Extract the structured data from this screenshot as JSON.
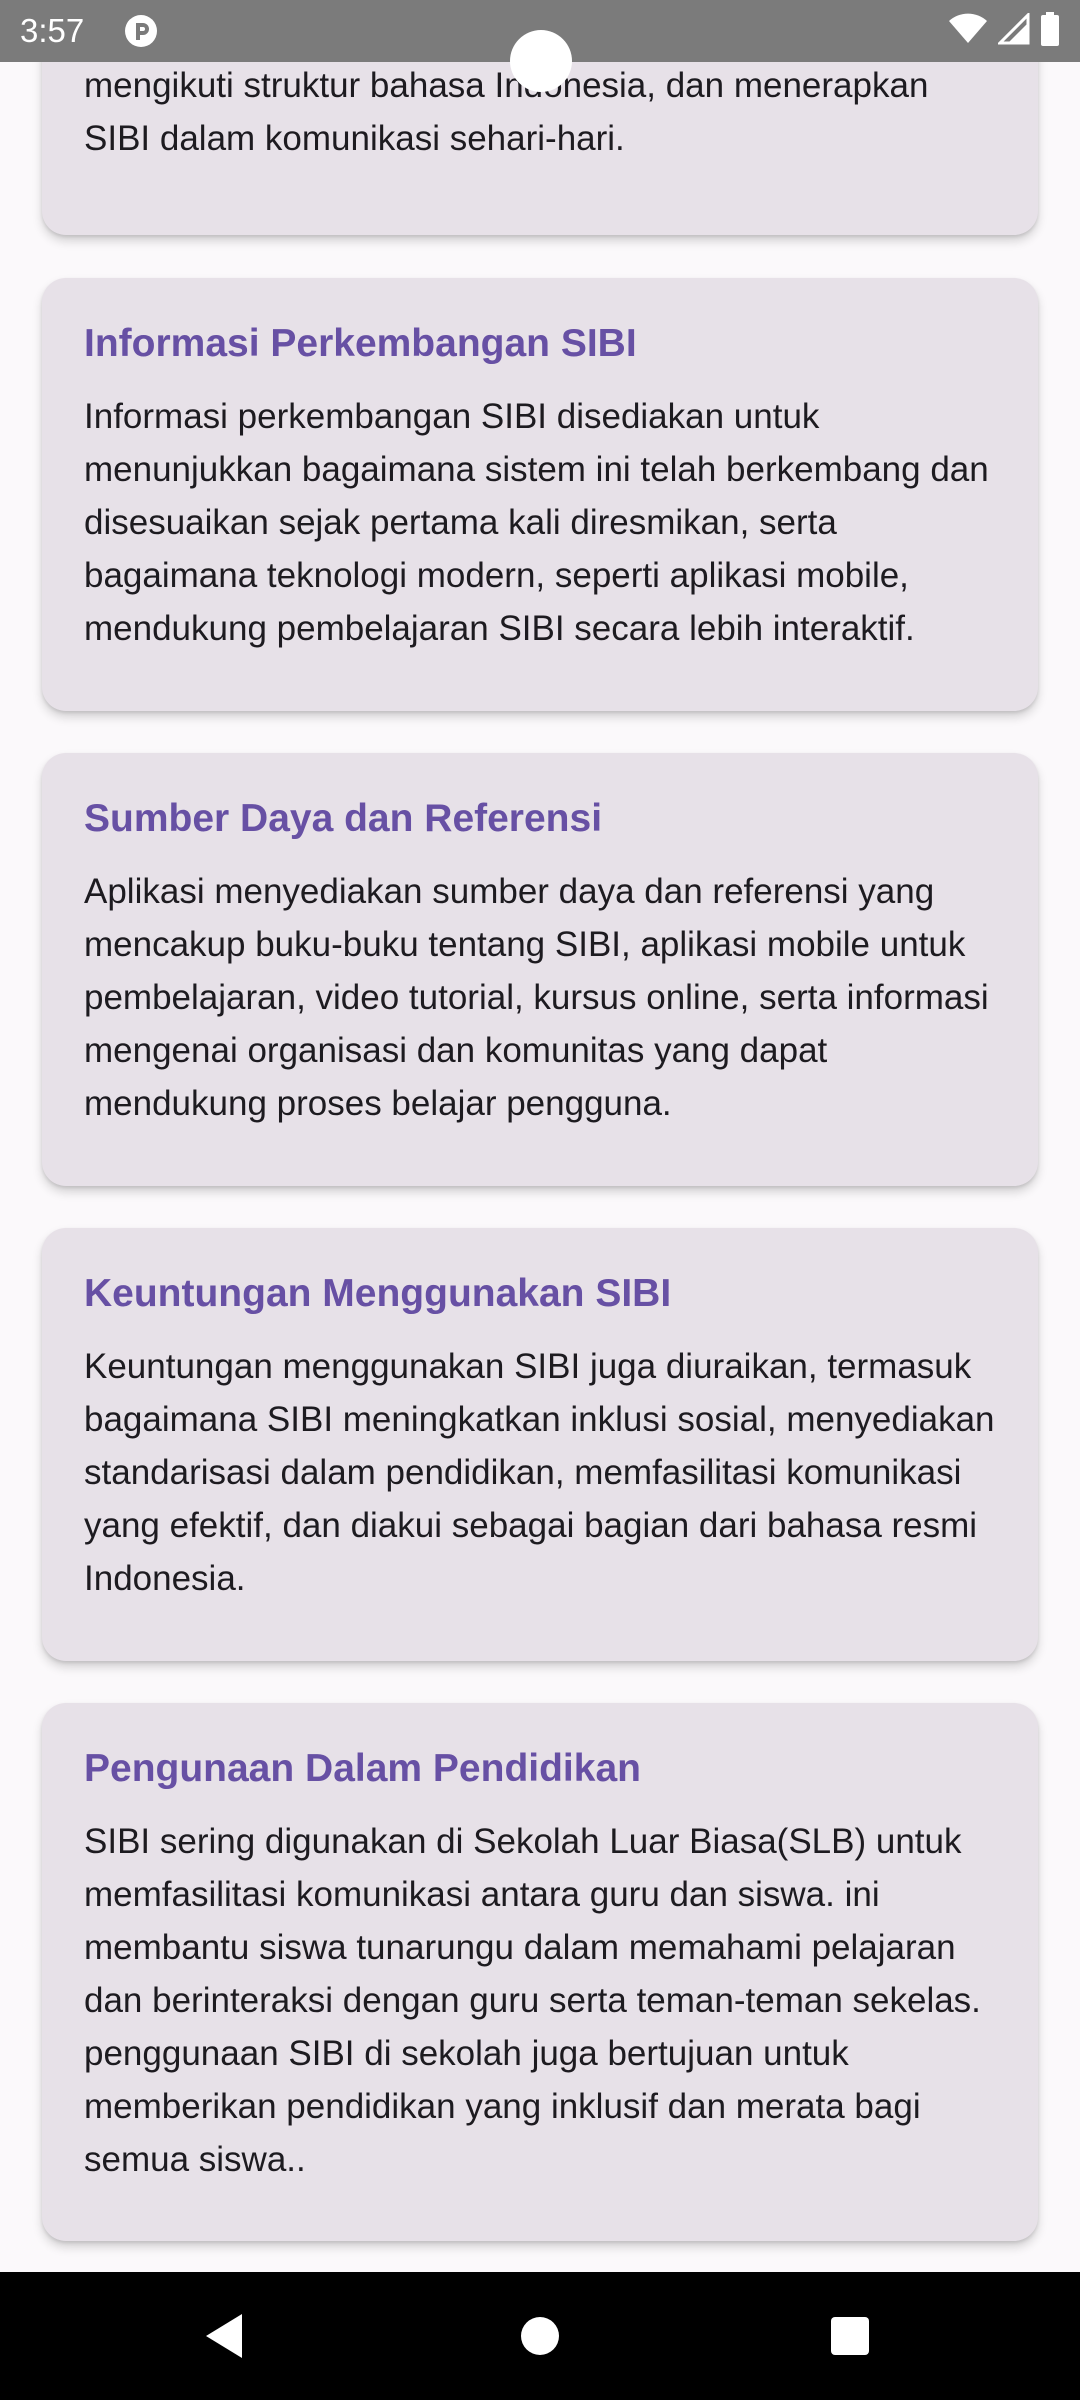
{
  "status_bar": {
    "time": "3:57",
    "icons": [
      "app-p-icon",
      "wifi-icon",
      "signal-icon",
      "battery-icon"
    ]
  },
  "cards": [
    {
      "partial": true,
      "title": "",
      "body": "mempelajari gerakan SIBI, memahami tata bahasa yang mengikuti struktur bahasa Indonesia, dan menerapkan SIBI dalam komunikasi sehari-hari."
    },
    {
      "title": "Informasi Perkembangan SIBI",
      "body": "Informasi perkembangan SIBI disediakan untuk menunjukkan bagaimana sistem ini telah berkembang dan disesuaikan sejak pertama kali diresmikan, serta bagaimana teknologi modern, seperti aplikasi mobile, mendukung pembelajaran SIBI secara lebih interaktif."
    },
    {
      "title": "Sumber Daya dan Referensi",
      "body": "Aplikasi menyediakan sumber daya dan referensi yang mencakup buku-buku tentang SIBI, aplikasi mobile untuk pembelajaran, video tutorial, kursus online, serta informasi mengenai organisasi dan komunitas yang dapat mendukung proses belajar pengguna."
    },
    {
      "title": "Keuntungan Menggunakan SIBI",
      "body": "Keuntungan menggunakan SIBI juga diuraikan, termasuk bagaimana SIBI meningkatkan inklusi sosial, menyediakan standarisasi dalam pendidikan, memfasilitasi komunikasi yang efektif, dan diakui sebagai bagian dari bahasa resmi Indonesia."
    },
    {
      "title": "Pengunaan Dalam Pendidikan",
      "body": "SIBI sering digunakan di Sekolah Luar Biasa(SLB) untuk memfasilitasi komunikasi antara guru dan siswa. ini membantu siswa tunarungu dalam memahami pelajaran dan berinteraksi dengan guru serta teman-teman sekelas. penggunaan SIBI di sekolah juga bertujuan untuk memberikan pendidikan yang inklusif dan merata bagi semua siswa.."
    }
  ],
  "nav_bar": {
    "buttons": [
      "back-icon",
      "home-icon",
      "recents-icon"
    ]
  },
  "colors": {
    "title": "#6750a4",
    "card_bg": "#e7e1e8",
    "page_bg": "#fbf9fb",
    "body_text": "#1d1b20"
  }
}
